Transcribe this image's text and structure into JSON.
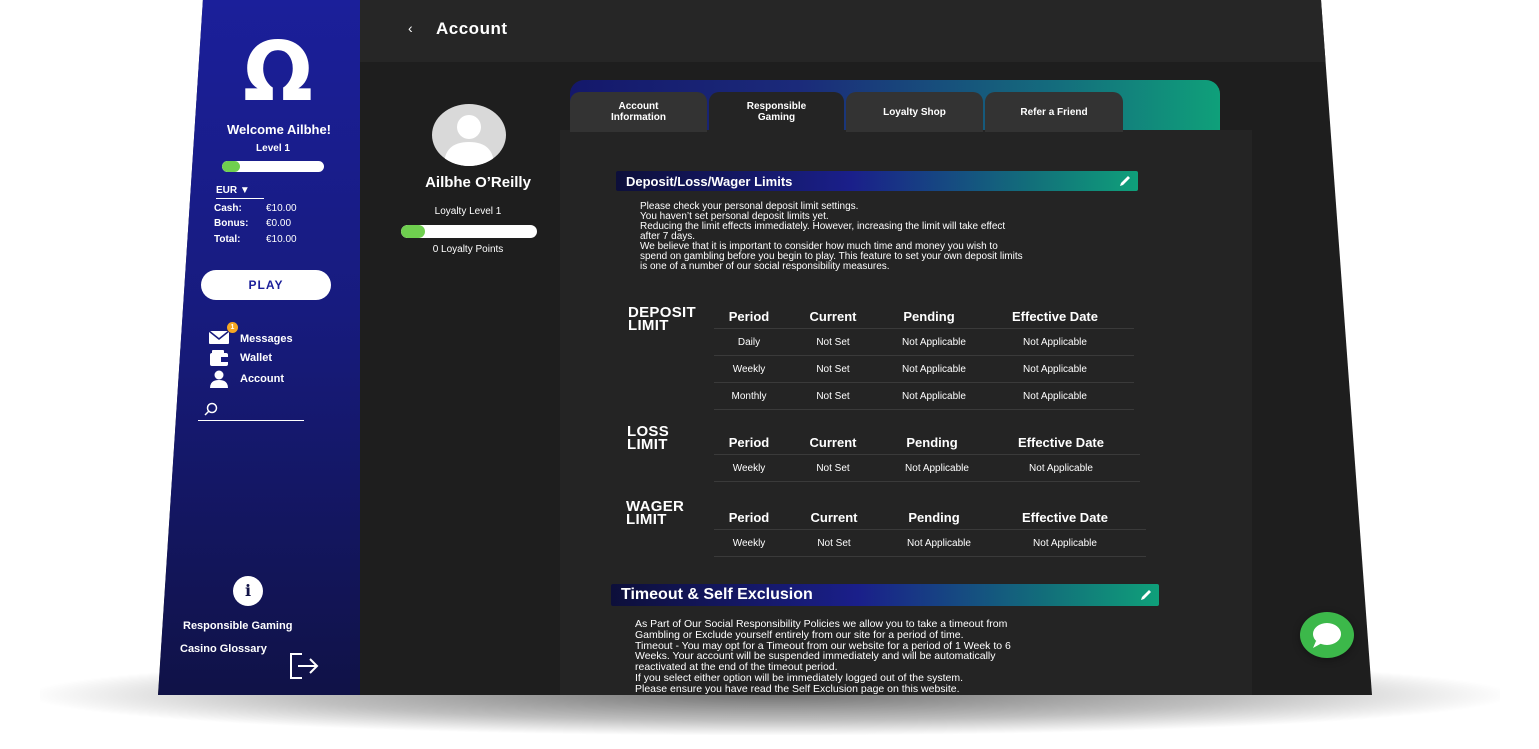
{
  "header": {
    "title": "Account"
  },
  "sidebar": {
    "welcome": "Welcome Ailbhe!",
    "level": "Level 1",
    "level_progress": 0.18,
    "currency": "EUR",
    "balances": [
      {
        "label": "Cash:",
        "value": "€10.00"
      },
      {
        "label": "Bonus:",
        "value": "€0.00"
      },
      {
        "label": "Total:",
        "value": "€10.00"
      }
    ],
    "play_label": "PLAY",
    "nav": [
      {
        "label": "Messages",
        "icon": "mail-icon",
        "badge": "1"
      },
      {
        "label": "Wallet",
        "icon": "wallet-icon"
      },
      {
        "label": "Account",
        "icon": "user-icon"
      }
    ],
    "search_placeholder": "",
    "footer": {
      "responsible": "Responsible Gaming",
      "glossary": "Casino Glossary",
      "info_glyph": "i"
    }
  },
  "profile": {
    "name": "Ailbhe O’Reilly",
    "loyalty_level": "Loyalty Level 1",
    "loyalty_progress": 0.18,
    "loyalty_points": "0 Loyalty Points"
  },
  "tabs": [
    {
      "label": "Account\nInformation",
      "active": false
    },
    {
      "label": "Responsible\nGaming",
      "active": true
    },
    {
      "label": "Loyalty Shop",
      "active": false
    },
    {
      "label": "Refer a Friend",
      "active": false
    }
  ],
  "limits_section": {
    "title": "Deposit/Loss/Wager Limits",
    "paragraphs": [
      "Please check your personal deposit limit settings.",
      "You haven’t set personal deposit limits yet.",
      "Reducing the limit effects immediately. However, increasing the limit will take effect",
      "after 7 days.",
      "We believe that it is important to consider how much time and money you wish to",
      "spend on gambling before you begin to play. This feature to set your own deposit limits",
      "is one of a number of our social responsibility measures."
    ],
    "columns": [
      "Period",
      "Current",
      "Pending",
      "Effective Date"
    ],
    "tables": [
      {
        "title_line1": "DEPOSIT",
        "title_line2": "LIMIT",
        "rows": [
          [
            "Daily",
            "Not Set",
            "Not Applicable",
            "Not Applicable"
          ],
          [
            "Weekly",
            "Not Set",
            "Not Applicable",
            "Not Applicable"
          ],
          [
            "Monthly",
            "Not Set",
            "Not Applicable",
            "Not Applicable"
          ]
        ]
      },
      {
        "title_line1": "LOSS",
        "title_line2": "LIMIT",
        "rows": [
          [
            "Weekly",
            "Not Set",
            "Not Applicable",
            "Not Applicable"
          ]
        ]
      },
      {
        "title_line1": "WAGER",
        "title_line2": "LIMIT",
        "rows": [
          [
            "Weekly",
            "Not Set",
            "Not Applicable",
            "Not Applicable"
          ]
        ]
      }
    ]
  },
  "timeout_section": {
    "title": "Timeout & Self Exclusion",
    "paragraphs": [
      "As Part of Our Social Responsibility Policies we allow you to take a timeout from",
      "Gambling or Exclude yourself entirely from our site for a period of time.",
      "Timeout - You may opt for a Timeout from our website for a period of 1 Week to 6",
      "Weeks. Your account will be suspended immediately and will be automatically",
      "reactivated at the end of the timeout period.",
      "If you select either option will be immediately logged out of the system.",
      "Please ensure you have read the Self Exclusion page on this website."
    ]
  },
  "colors": {
    "sidebar": "#1b1f9a",
    "accent_green": "#6fcf4f",
    "chat_green": "#3cb84a",
    "panel": "#242424"
  }
}
